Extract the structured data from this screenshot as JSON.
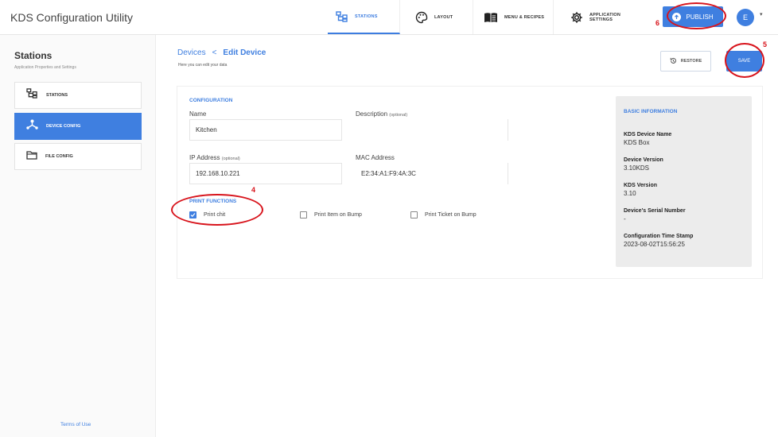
{
  "app": {
    "title": "KDS Configuration Utility"
  },
  "nav": {
    "tabs": [
      {
        "label": "STATIONS",
        "icon": "stations-icon",
        "active": true
      },
      {
        "label": "LAYOUT",
        "icon": "palette-icon",
        "active": false
      },
      {
        "label": "MENU & RECIPES",
        "icon": "menu-book-icon",
        "active": false
      },
      {
        "label": "APPLICATION SETTINGS",
        "icon": "gear-icon",
        "active": false
      }
    ],
    "publish_label": "PUBLISH",
    "avatar_initial": "E"
  },
  "sidebar": {
    "title": "Stations",
    "subtitle": "Application Properties and Settings",
    "items": [
      {
        "label": "STATIONS",
        "icon": "stations-icon",
        "active": false
      },
      {
        "label": "DEVICE CONFIG",
        "icon": "device-hub-icon",
        "active": true
      },
      {
        "label": "FILE CONFIG",
        "icon": "folder-icon",
        "active": false
      }
    ],
    "terms_link": "Terms of Use"
  },
  "main": {
    "breadcrumb": {
      "parent": "Devices",
      "separator": "<",
      "current": "Edit Device"
    },
    "subtitle": "Here you can edit your data",
    "restore_label": "RESTORE",
    "save_label": "SAVE",
    "configuration": {
      "heading": "CONFIGURATION",
      "name": {
        "label": "Name",
        "value": "Kitchen"
      },
      "description": {
        "label": "Description",
        "optional": "(optional)",
        "value": ""
      },
      "ip": {
        "label": "IP Address",
        "optional": "(optional)",
        "value": "192.168.10.221"
      },
      "mac": {
        "label": "MAC Address",
        "value": "E2:34:A1:F9:4A:3C"
      }
    },
    "print_functions": {
      "heading": "PRINT FUNCTIONS",
      "options": [
        {
          "label": "Print chit",
          "checked": true
        },
        {
          "label": "Print Item on Bump",
          "checked": false
        },
        {
          "label": "Print Ticket on Bump",
          "checked": false
        }
      ]
    },
    "basic_info": {
      "heading": "BASIC INFORMATION",
      "fields": [
        {
          "key": "KDS Device Name",
          "value": "KDS Box"
        },
        {
          "key": "Device Version",
          "value": "3.10KDS"
        },
        {
          "key": "KDS Version",
          "value": "3.10"
        },
        {
          "key": "Device's Serial Number",
          "value": "-"
        },
        {
          "key": "Configuration Time Stamp",
          "value": "2023-08-02T15:56:25"
        }
      ]
    }
  },
  "annotations": {
    "marker_color": "#d8141c",
    "labels": [
      "4",
      "5",
      "6"
    ]
  },
  "colors": {
    "accent": "#3f7fe0",
    "panel": "#ececec"
  }
}
